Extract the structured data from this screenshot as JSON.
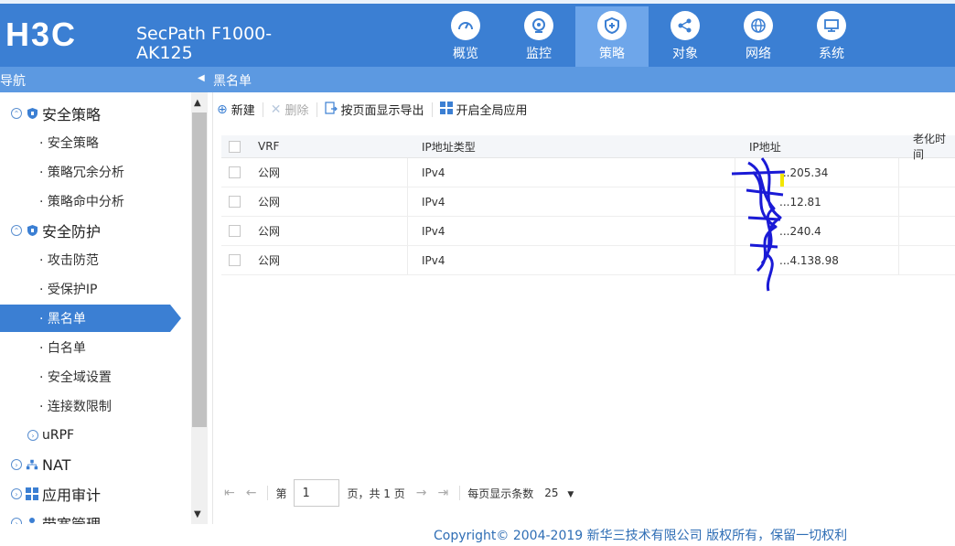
{
  "header": {
    "logo": "H3C",
    "model_line1": "SecPath F1000-",
    "model_line2": "AK125",
    "nav": [
      {
        "label": "概览",
        "icon": "speedometer-icon"
      },
      {
        "label": "监控",
        "icon": "webcam-icon"
      },
      {
        "label": "策略",
        "icon": "shield-plus-icon",
        "active": true
      },
      {
        "label": "对象",
        "icon": "share-icon"
      },
      {
        "label": "网络",
        "icon": "globe-icon"
      },
      {
        "label": "系统",
        "icon": "monitor-icon"
      }
    ]
  },
  "subbar": {
    "nav_title": "导航",
    "page_title": "黑名单"
  },
  "sidebar": {
    "groups": [
      {
        "label": "安全策略",
        "icon": "shield-icon"
      },
      {
        "label": "安全防护",
        "icon": "shield-icon"
      },
      {
        "label": "uRPF",
        "icon": ""
      },
      {
        "label": "NAT",
        "icon": "network-icon"
      },
      {
        "label": "应用审计",
        "icon": "grid-icon"
      },
      {
        "label": "带宽管理",
        "icon": "user-icon"
      }
    ],
    "items": [
      {
        "label": "· 安全策略"
      },
      {
        "label": "· 策略冗余分析"
      },
      {
        "label": "· 策略命中分析"
      },
      {
        "label": "· 攻击防范"
      },
      {
        "label": "· 受保护IP"
      },
      {
        "label": "· 黑名单",
        "active": true
      },
      {
        "label": "· 白名单"
      },
      {
        "label": "· 安全域设置"
      },
      {
        "label": "· 连接数限制"
      }
    ]
  },
  "toolbar": {
    "new_label": "新建",
    "delete_label": "删除",
    "export_label": "按页面显示导出",
    "global_label": "开启全局应用"
  },
  "table": {
    "columns": [
      "VRF",
      "IP地址类型",
      "IP地址",
      "老化时间"
    ],
    "rows": [
      {
        "vrf": "公网",
        "type": "IPv4",
        "ip": "...205.34"
      },
      {
        "vrf": "公网",
        "type": "IPv4",
        "ip": "...12.81"
      },
      {
        "vrf": "公网",
        "type": "IPv4",
        "ip": "...240.4"
      },
      {
        "vrf": "公网",
        "type": "IPv4",
        "ip": "...4.138.98"
      }
    ]
  },
  "pager": {
    "page_prefix": "第",
    "page_value": "1",
    "page_suffix": "页，共 1 页",
    "per_page_label": "每页显示条数",
    "per_page_value": "25"
  },
  "footer": {
    "copyright": "Copyright© 2004-2019 新华三技术有限公司 版权所有，保留一切权利"
  },
  "colors": {
    "brand": "#3b7fd3",
    "subbar": "#5c99e1",
    "active_nav": "#6ea6ea"
  }
}
